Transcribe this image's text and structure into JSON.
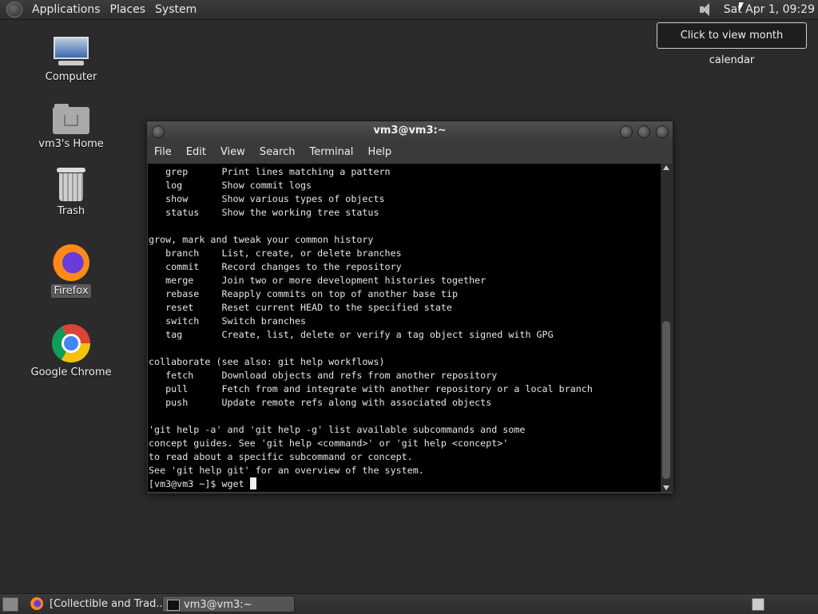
{
  "top_panel": {
    "menus": [
      "Applications",
      "Places",
      "System"
    ],
    "clock": "Sat Apr  1, 09:29",
    "tooltip": "Click to view month calendar"
  },
  "desktop": {
    "icons": [
      {
        "label": "Computer"
      },
      {
        "label": "vm3's Home"
      },
      {
        "label": "Trash"
      },
      {
        "label": "Firefox"
      },
      {
        "label": "Google Chrome"
      }
    ]
  },
  "terminal_window": {
    "title": "vm3@vm3:~",
    "menu": [
      "File",
      "Edit",
      "View",
      "Search",
      "Terminal",
      "Help"
    ],
    "lines": [
      "   grep      Print lines matching a pattern",
      "   log       Show commit logs",
      "   show      Show various types of objects",
      "   status    Show the working tree status",
      "",
      "grow, mark and tweak your common history",
      "   branch    List, create, or delete branches",
      "   commit    Record changes to the repository",
      "   merge     Join two or more development histories together",
      "   rebase    Reapply commits on top of another base tip",
      "   reset     Reset current HEAD to the specified state",
      "   switch    Switch branches",
      "   tag       Create, list, delete or verify a tag object signed with GPG",
      "",
      "collaborate (see also: git help workflows)",
      "   fetch     Download objects and refs from another repository",
      "   pull      Fetch from and integrate with another repository or a local branch",
      "   push      Update remote refs along with associated objects",
      "",
      "'git help -a' and 'git help -g' list available subcommands and some",
      "concept guides. See 'git help <command>' or 'git help <concept>'",
      "to read about a specific subcommand or concept.",
      "See 'git help git' for an overview of the system."
    ],
    "prompt": "[vm3@vm3 ~]$ wget "
  },
  "taskbar": {
    "tasks": [
      "[Collectible and Trad...",
      "vm3@vm3:~"
    ]
  }
}
